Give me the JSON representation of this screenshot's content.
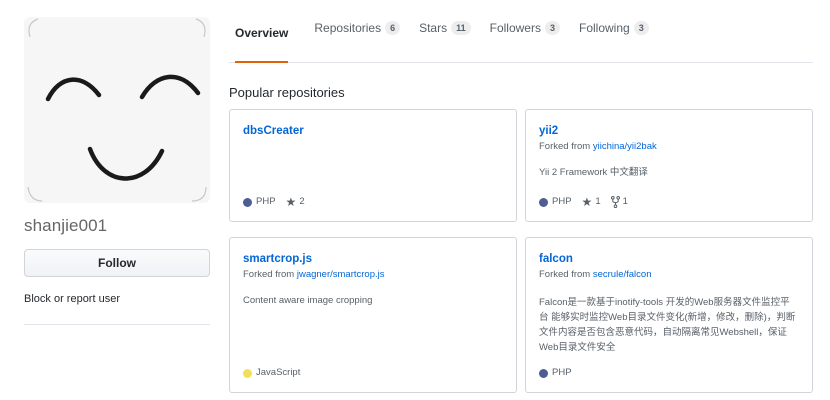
{
  "profile": {
    "username": "shanjie001",
    "follow_label": "Follow",
    "block_label": "Block or report user"
  },
  "tabs": [
    {
      "label": "Overview",
      "count": null,
      "selected": true
    },
    {
      "label": "Repositories",
      "count": "6",
      "selected": false
    },
    {
      "label": "Stars",
      "count": "11",
      "selected": false
    },
    {
      "label": "Followers",
      "count": "3",
      "selected": false
    },
    {
      "label": "Following",
      "count": "3",
      "selected": false
    }
  ],
  "section_title": "Popular repositories",
  "repos": [
    {
      "name": "dbsCreater",
      "fork_prefix": "",
      "fork_source": "",
      "description": "",
      "language": "PHP",
      "language_color": "#4F5D95",
      "stars": "2",
      "forks": ""
    },
    {
      "name": "yii2",
      "fork_prefix": "Forked from ",
      "fork_source": "yiichina/yii2bak",
      "description": "Yii 2 Framework 中文翻译",
      "language": "PHP",
      "language_color": "#4F5D95",
      "stars": "1",
      "forks": "1"
    },
    {
      "name": "smartcrop.js",
      "fork_prefix": "Forked from ",
      "fork_source": "jwagner/smartcrop.js",
      "description": "Content aware image cropping",
      "language": "JavaScript",
      "language_color": "#f1e05a",
      "stars": "",
      "forks": ""
    },
    {
      "name": "falcon",
      "fork_prefix": "Forked from ",
      "fork_source": "secrule/falcon",
      "description": "Falcon是一款基于inotify-tools 开发的Web服务器文件监控平台 能够实时监控Web目录文件变化(新增，修改，删除)，判断文件内容是否包含恶意代码，自动隔离常见Webshell，保证Web目录文件安全",
      "language": "PHP",
      "language_color": "#4F5D95",
      "stars": "",
      "forks": ""
    }
  ],
  "icons": {
    "star": "star-icon",
    "fork": "repo-forked-icon"
  },
  "colors": {
    "link": "#0366d6",
    "tab_underline": "#e36209",
    "border": "#d1d5da"
  }
}
